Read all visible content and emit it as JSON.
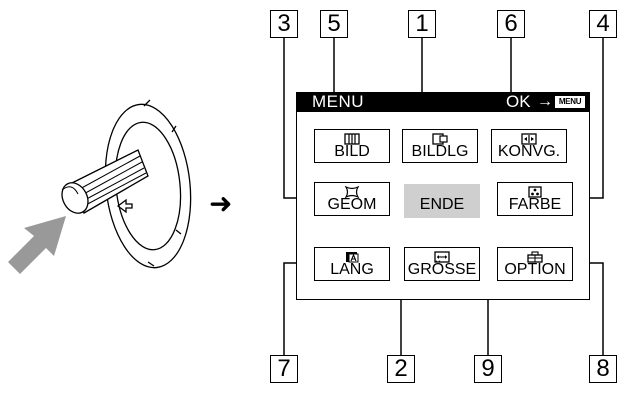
{
  "menu": {
    "title": "MENU",
    "ok_label": "OK",
    "ok_arrow": "→",
    "menu_key_label": "MENU"
  },
  "buttons": [
    {
      "id": "bild",
      "label": "BILD",
      "icon": "bars-icon"
    },
    {
      "id": "bildlg",
      "label": "BILDLG",
      "icon": "position-icon"
    },
    {
      "id": "konvg",
      "label": "KONVG.",
      "icon": "convergence-icon"
    },
    {
      "id": "geom",
      "label": "GEOM",
      "icon": "geometry-icon"
    },
    {
      "id": "ende",
      "label": "ENDE",
      "icon": null
    },
    {
      "id": "farbe",
      "label": "FARBE",
      "icon": "color-dots-icon"
    },
    {
      "id": "lang",
      "label": "LANG",
      "icon": "language-icon"
    },
    {
      "id": "groesse",
      "label": "GRÖSSE",
      "icon": "size-arrows-icon"
    },
    {
      "id": "option",
      "label": "OPTION",
      "icon": "option-icon"
    }
  ],
  "callouts": [
    "3",
    "5",
    "1",
    "6",
    "4",
    "7",
    "2",
    "9",
    "8"
  ],
  "colors": {
    "end_highlight": "#cfcfcf",
    "arrow_fill": "#999999"
  }
}
